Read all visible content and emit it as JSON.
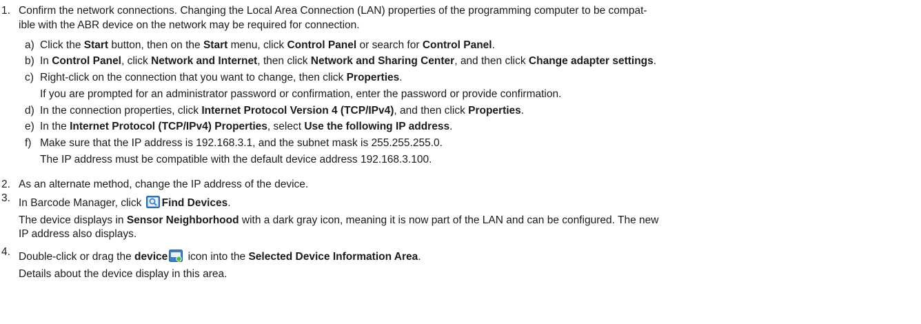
{
  "steps": [
    {
      "num": "1.",
      "line1": "Confirm the network connections. Changing the Local Area Connection (LAN) properties of the programming computer to be compat-",
      "line2": "ible with the ABR device on the network may be required for connection.",
      "substeps": [
        {
          "letter": "a)",
          "parts": [
            "Click the ",
            "Start",
            " button, then on the ",
            "Start",
            " menu, click ",
            "Control Panel",
            " or search for ",
            "Control Panel",
            "."
          ]
        },
        {
          "letter": "b)",
          "parts": [
            "In ",
            "Control Panel",
            ", click ",
            "Network and Internet",
            ", then click ",
            "Network and Sharing Center",
            ", and then click ",
            "Change adapter settings",
            "."
          ]
        },
        {
          "letter": "c)",
          "parts": [
            "Right-click on the connection that you want to change, then click ",
            "Properties",
            "."
          ]
        },
        {
          "letter": "",
          "parts": [
            "If you are prompted for an administrator password or confirmation, enter the password or provide confirmation."
          ]
        },
        {
          "letter": "d)",
          "parts": [
            "In the connection properties, click ",
            "Internet Protocol Version 4 (TCP/IPv4)",
            ", and then click ",
            "Properties",
            "."
          ]
        },
        {
          "letter": "e)",
          "parts": [
            "In the ",
            "Internet Protocol (TCP/IPv4) Properties",
            ", select ",
            "Use the following IP address",
            "."
          ]
        },
        {
          "letter": "f)",
          "parts": [
            "Make sure that the IP address is 192.168.3.1, and the subnet mask is 255.255.255.0."
          ]
        },
        {
          "letter": "",
          "parts": [
            "The IP address must be compatible with the default device address 192.168.3.100."
          ]
        }
      ]
    },
    {
      "num": "2.",
      "line1": "As an alternate method, change the IP address of the device."
    },
    {
      "num": "3.",
      "line1_before": "In Barcode Manager, click ",
      "line1_icon": "find-devices-icon",
      "line1_bold": "Find Devices",
      "line1_after": ".",
      "line2_parts": [
        "The device displays in ",
        "Sensor Neighborhood",
        " with a dark gray icon, meaning it is now part of the LAN and can be configured. The new"
      ],
      "line3": "IP address also displays."
    },
    {
      "num": "4.",
      "line1_parts": [
        "Double-click or drag the ",
        "device",
        " icon into the ",
        "Selected Device Information Area",
        "."
      ],
      "line1_icon": "device-icon",
      "line2": "Details about the device display in this area."
    }
  ],
  "colors": {
    "text": "#1a1a1a",
    "icon_blue": "#3b7fc4",
    "icon_green": "#3fbf3f"
  }
}
